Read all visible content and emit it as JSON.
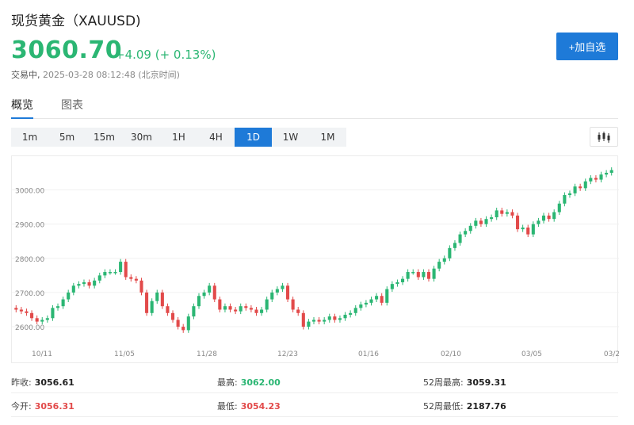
{
  "header": {
    "title": "现货黄金（XAUUSD)",
    "price": "3060.70",
    "change": "+4.09 (+ 0.13%)",
    "status": "交易中,",
    "time": "2025-03-28 08:12:48 (北京时间)",
    "add_label": "+加自选"
  },
  "tabs": [
    {
      "label": "概览",
      "active": true
    },
    {
      "label": "图表",
      "active": false
    }
  ],
  "periods": [
    "1m",
    "5m",
    "15m",
    "30m",
    "1H",
    "4H",
    "1D",
    "1W",
    "1M"
  ],
  "active_period": "1D",
  "colors": {
    "up": "#2bb673",
    "down": "#e24a4a",
    "accent": "#1e7ad8"
  },
  "chart_data": {
    "type": "candlestick",
    "ylim": [
      2570,
      3080
    ],
    "y_ticks": [
      "2600.00",
      "2700.00",
      "2800.00",
      "2900.00",
      "3000.00"
    ],
    "x_ticks": [
      "10/11",
      "11/05",
      "11/28",
      "12/23",
      "01/16",
      "02/10",
      "03/05",
      "03/2"
    ],
    "close_series": [
      2650,
      2645,
      2640,
      2625,
      2615,
      2620,
      2625,
      2655,
      2660,
      2680,
      2700,
      2720,
      2725,
      2730,
      2720,
      2735,
      2750,
      2760,
      2760,
      2760,
      2790,
      2745,
      2740,
      2735,
      2700,
      2640,
      2675,
      2700,
      2660,
      2640,
      2620,
      2600,
      2590,
      2630,
      2660,
      2690,
      2700,
      2720,
      2680,
      2650,
      2660,
      2650,
      2645,
      2660,
      2655,
      2650,
      2640,
      2650,
      2680,
      2700,
      2710,
      2720,
      2680,
      2650,
      2640,
      2600,
      2615,
      2620,
      2615,
      2620,
      2630,
      2620,
      2625,
      2635,
      2640,
      2655,
      2665,
      2670,
      2680,
      2690,
      2670,
      2710,
      2725,
      2730,
      2740,
      2760,
      2760,
      2745,
      2760,
      2740,
      2770,
      2790,
      2800,
      2830,
      2845,
      2870,
      2880,
      2895,
      2910,
      2900,
      2915,
      2920,
      2940,
      2930,
      2935,
      2925,
      2885,
      2890,
      2870,
      2900,
      2910,
      2925,
      2915,
      2935,
      2960,
      2985,
      2990,
      3010,
      3005,
      3025,
      3035,
      3030,
      3045,
      3050,
      3058
    ]
  },
  "stats": {
    "prev_close_label": "昨收:",
    "prev_close": "3056.61",
    "high_label": "最高:",
    "high": "3062.00",
    "high52_label": "52周最高:",
    "high52": "3059.31",
    "open_label": "今开:",
    "open": "3056.31",
    "low_label": "最低:",
    "low": "3054.23",
    "low52_label": "52周最低:",
    "low52": "2187.76"
  }
}
